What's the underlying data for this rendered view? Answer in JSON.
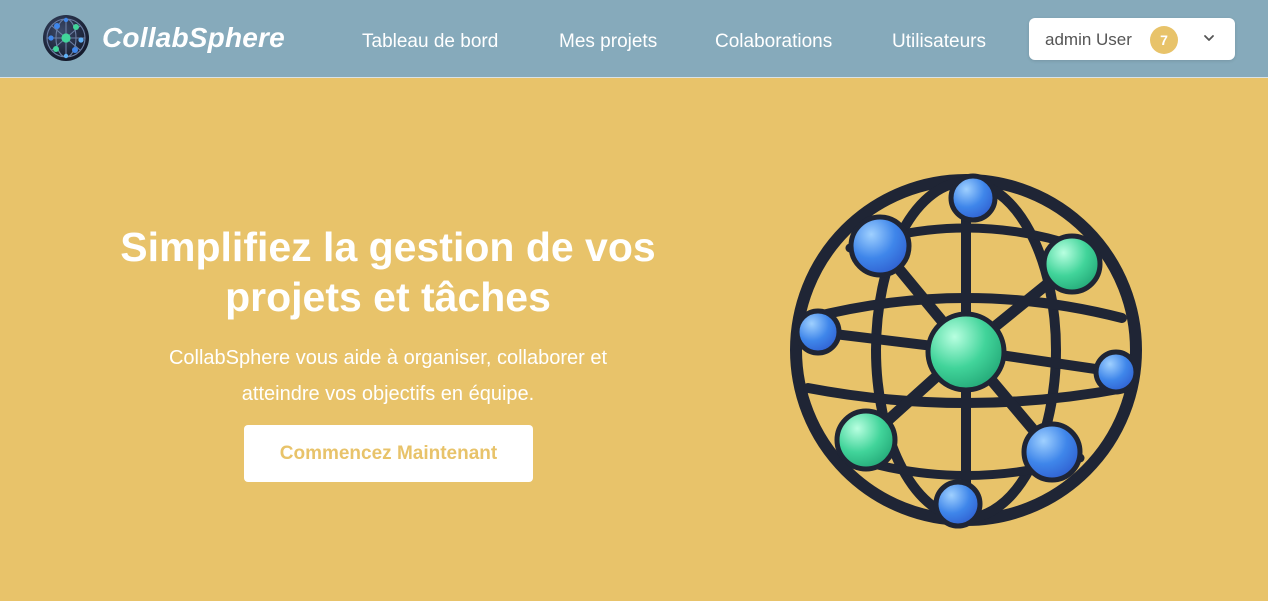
{
  "brand": {
    "name": "CollabSphere",
    "logo_icon": "network-globe-icon"
  },
  "nav": {
    "items": [
      {
        "label": "Tableau de bord"
      },
      {
        "label": "Mes projets"
      },
      {
        "label": "Colaborations"
      },
      {
        "label": "Utilisateurs"
      }
    ]
  },
  "user_menu": {
    "name": "admin User",
    "badge_count": "7",
    "dropdown_icon": "chevron-down-icon"
  },
  "hero": {
    "title_line1": "Simplifiez la gestion de vos",
    "title_line2": "projets et tâches",
    "subtitle_line1": "CollabSphere vous aide à organiser, collaborer et",
    "subtitle_line2": "atteindre vos objectifs en équipe.",
    "cta_label": "Commencez Maintenant",
    "illustration_icon": "network-globe-illustration"
  },
  "colors": {
    "navbar": "#86aabb",
    "hero_background": "#e8c36a",
    "accent": "#e8c36a",
    "text_on_color": "#ffffff",
    "globe_frame": "#1f2535",
    "node_blue": "#3f86ea",
    "node_green": "#41d49a"
  }
}
